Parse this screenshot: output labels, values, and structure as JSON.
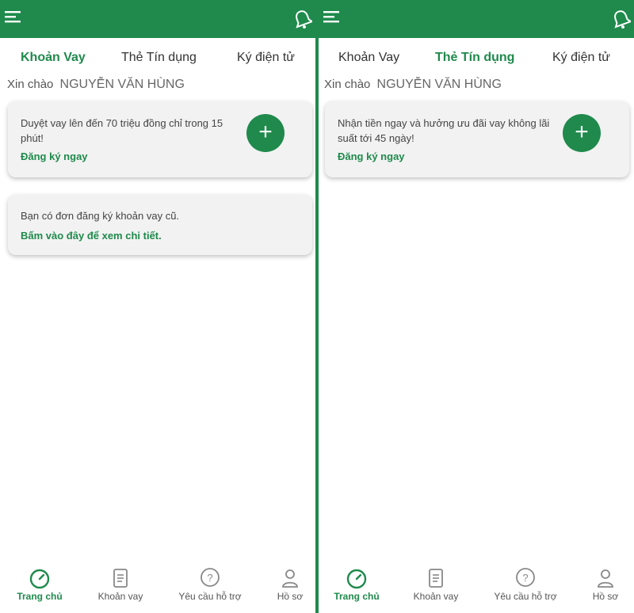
{
  "screens": [
    {
      "tabs": [
        "Khoản Vay",
        "Thẻ Tín dụng",
        "Ký điện tử"
      ],
      "active_tab": 0,
      "greeting_prefix": "Xin chào",
      "user_name": "NGUYỄN VĂN HÙNG",
      "card1": {
        "text": "Duyệt vay lên đến 70 triệu đồng chỉ trong 15 phút!",
        "link": "Đăng ký ngay",
        "button_symbol": "+"
      },
      "card2": {
        "text": "Bạn có đơn đăng ký khoản vay cũ.",
        "link": "Bấm vào đây để xem chi tiết."
      },
      "nav": [
        {
          "label": "Trang chủ",
          "icon": "speedometer-icon"
        },
        {
          "label": "Khoản vay",
          "icon": "document-icon"
        },
        {
          "label": "Yêu cầu hỗ trợ",
          "icon": "help-icon"
        },
        {
          "label": "Hồ sơ",
          "icon": "user-icon"
        }
      ],
      "active_nav": 0
    },
    {
      "tabs": [
        "Khoản Vay",
        "Thẻ Tín dụng",
        "Ký điện tử"
      ],
      "active_tab": 1,
      "greeting_prefix": "Xin chào",
      "user_name": "NGUYỄN VĂN HÙNG",
      "card1": {
        "text": "Nhận tiền ngay và hưởng ưu đãi vay không lãi suất tới 45 ngày!",
        "link": "Đăng ký ngay",
        "button_symbol": "+"
      },
      "nav": [
        {
          "label": "Trang chủ",
          "icon": "speedometer-icon"
        },
        {
          "label": "Khoản vay",
          "icon": "document-icon"
        },
        {
          "label": "Yêu cầu hỗ trợ",
          "icon": "help-icon"
        },
        {
          "label": "Hồ sơ",
          "icon": "user-icon"
        }
      ],
      "active_nav": 0
    }
  ],
  "colors": {
    "brand_green": "#1f8a4c",
    "card_bg": "#f2f2f2",
    "text_dark": "#333333"
  }
}
